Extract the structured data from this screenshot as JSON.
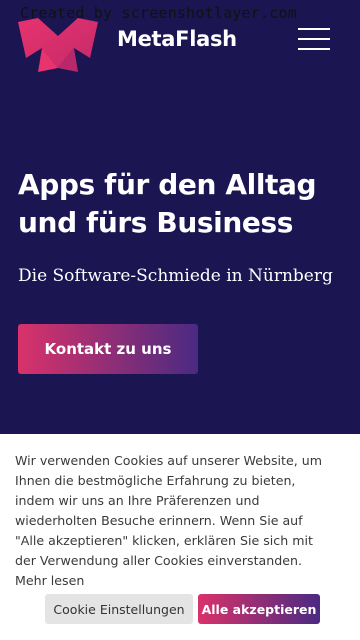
{
  "watermark": "Created by screenshotlayer.com",
  "header": {
    "brand": "MetaFlash",
    "logo_icon": "metaflash-m-logo",
    "menu_icon": "hamburger-menu-icon"
  },
  "hero": {
    "title_line1": "Apps für den Alltag",
    "title_line2": "und fürs Business",
    "subtitle": "Die Software-Schmiede in Nürnberg",
    "cta_label": "Kontakt zu uns"
  },
  "cookie_banner": {
    "text": "Wir verwenden Cookies auf unserer Website, um Ihnen die bestmögliche Erfahrung zu bieten, indem wir uns an Ihre Präferenzen und wiederholten Besuche erinnern. Wenn Sie auf \"Alle akzeptieren\" klicken, erklären Sie sich mit der Verwendung aller Cookies einverstanden.",
    "more_link": "Mehr lesen",
    "settings_label": "Cookie Einstellungen",
    "accept_label": "Alle akzeptieren"
  },
  "colors": {
    "background": "#1b1552",
    "accent_pink": "#d9326a",
    "accent_purple": "#4a2a82",
    "banner_background": "#ffffff"
  }
}
